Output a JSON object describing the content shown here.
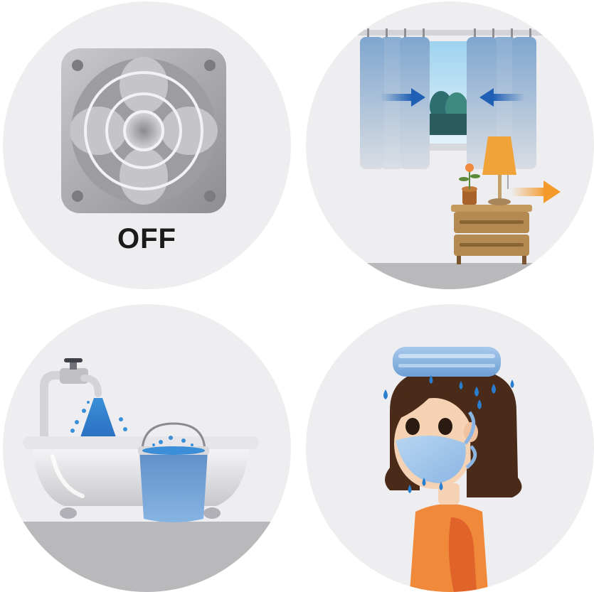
{
  "panels": [
    {
      "scene": "exhaust-fan",
      "label": "OFF"
    },
    {
      "scene": "closed-curtains-lamp"
    },
    {
      "scene": "bathtub-bucket"
    },
    {
      "scene": "person-mask-wet-towel"
    }
  ],
  "colors": {
    "panel_bg": "#eeeef0",
    "water_blue": "#3a8fd8",
    "arrow_blue": "#1f5fb5",
    "arrow_orange": "#f39a2b",
    "shirt_orange": "#f08a3a",
    "hair_brown": "#4a2a18",
    "floor_gray": "#b9b9bc"
  }
}
